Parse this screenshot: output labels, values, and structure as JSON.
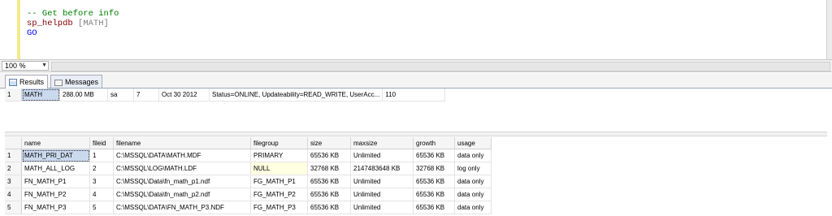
{
  "editor": {
    "line1": "-- Get before info",
    "line2_proc": "sp_helpdb",
    "line2_arg": "[MATH]",
    "line3": "GO"
  },
  "zoom": {
    "value": "100 %"
  },
  "tabs": [
    {
      "label": "Results"
    },
    {
      "label": "Messages"
    }
  ],
  "result1": {
    "rows": [
      [
        "1",
        "MATH",
        "288.00 MB",
        "sa",
        "7",
        "Oct 30 2012",
        "Status=ONLINE, Updateability=READ_WRITE, UserAcc...",
        "110"
      ]
    ]
  },
  "result2": {
    "columns": [
      "name",
      "fileid",
      "filename",
      "filegroup",
      "size",
      "maxsize",
      "growth",
      "usage"
    ],
    "rows": [
      [
        "1",
        "MATH_PRI_DAT",
        "1",
        "C:\\MSSQL\\DATA\\MATH.MDF",
        "PRIMARY",
        "65536 KB",
        "Unlimited",
        "65536 KB",
        "data only"
      ],
      [
        "2",
        "MATH_ALL_LOG",
        "2",
        "C:\\MSSQL\\LOG\\MATH.LDF",
        "NULL",
        "32768 KB",
        "2147483648 KB",
        "32768 KB",
        "log only"
      ],
      [
        "3",
        "FN_MATH_P1",
        "3",
        "C:\\MSSQL\\Data\\fn_math_p1.ndf",
        "FG_MATH_P1",
        "65536 KB",
        "Unlimited",
        "65536 KB",
        "data only"
      ],
      [
        "4",
        "FN_MATH_P2",
        "4",
        "C:\\MSSQL\\Data\\fn_math_p2.ndf",
        "FG_MATH_P2",
        "65536 KB",
        "Unlimited",
        "65536 KB",
        "data only"
      ],
      [
        "5",
        "FN_MATH_P3",
        "5",
        "C:\\MSSQL\\DATA\\FN_MATH_P3.NDF",
        "FG_MATH_P3",
        "65536 KB",
        "Unlimited",
        "65536 KB",
        "data only"
      ]
    ]
  }
}
